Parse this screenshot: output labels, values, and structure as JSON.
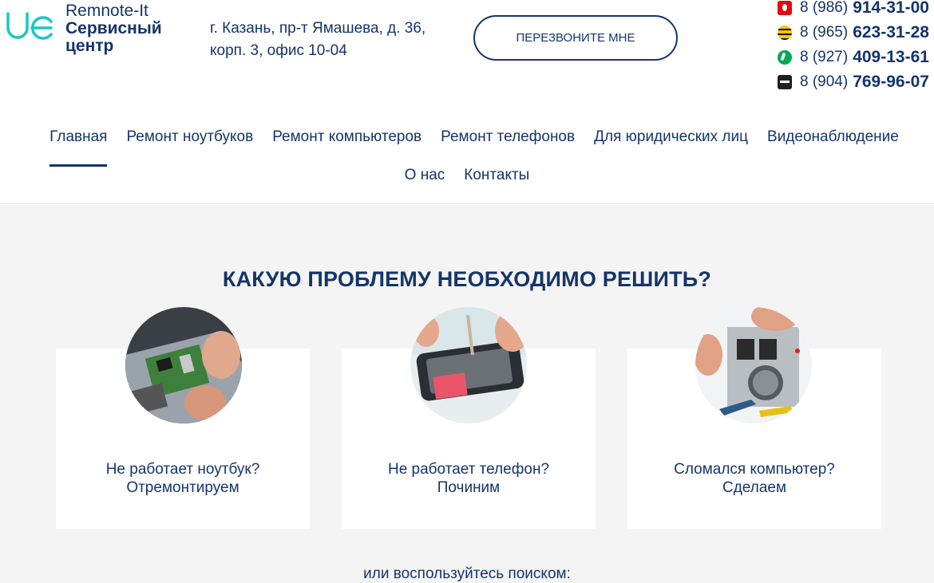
{
  "brand": {
    "line1": "Remnote-It",
    "line2": "Сервисный",
    "line3": "центр"
  },
  "address": {
    "line1": "г. Казань, пр-т Ямашева, д. 36,",
    "line2": "корп. 3, офис 10-04"
  },
  "callback_label": "ПЕРЕЗВОНИТЕ МНЕ",
  "phones": [
    {
      "operator_icon": "mts-icon",
      "code": "8 (986)",
      "number": "914-31-00"
    },
    {
      "operator_icon": "beeline-icon",
      "code": "8 (965)",
      "number": "623-31-28"
    },
    {
      "operator_icon": "megafon-icon",
      "code": "8 (927)",
      "number": "409-13-61"
    },
    {
      "operator_icon": "tele2-icon",
      "code": "8 (904)",
      "number": "769-96-07"
    }
  ],
  "nav": {
    "items": [
      "Главная",
      "Ремонт ноутбуков",
      "Ремонт компьютеров",
      "Ремонт телефонов",
      "Для юридических лиц",
      "Видеонаблюдение",
      "О нас",
      "Контакты"
    ],
    "active": "Главная"
  },
  "section_title": "КАКУЮ ПРОБЛЕМУ НЕОБХОДИМО РЕШИТЬ?",
  "cards": [
    {
      "line1": "Не работает ноутбук?",
      "line2": "Отремонтируем",
      "image": "laptop-repair-photo"
    },
    {
      "line1": "Не работает телефон?",
      "line2": "Починим",
      "image": "phone-repair-photo"
    },
    {
      "line1": "Сломался компьютер?",
      "line2": "Сделаем",
      "image": "computer-repair-photo"
    }
  ],
  "search_hint": "или воспользуйтесь поиском:",
  "colors": {
    "primary": "#14356b",
    "logo_accent": "#18c6c6",
    "background": "#f4f4f4"
  }
}
